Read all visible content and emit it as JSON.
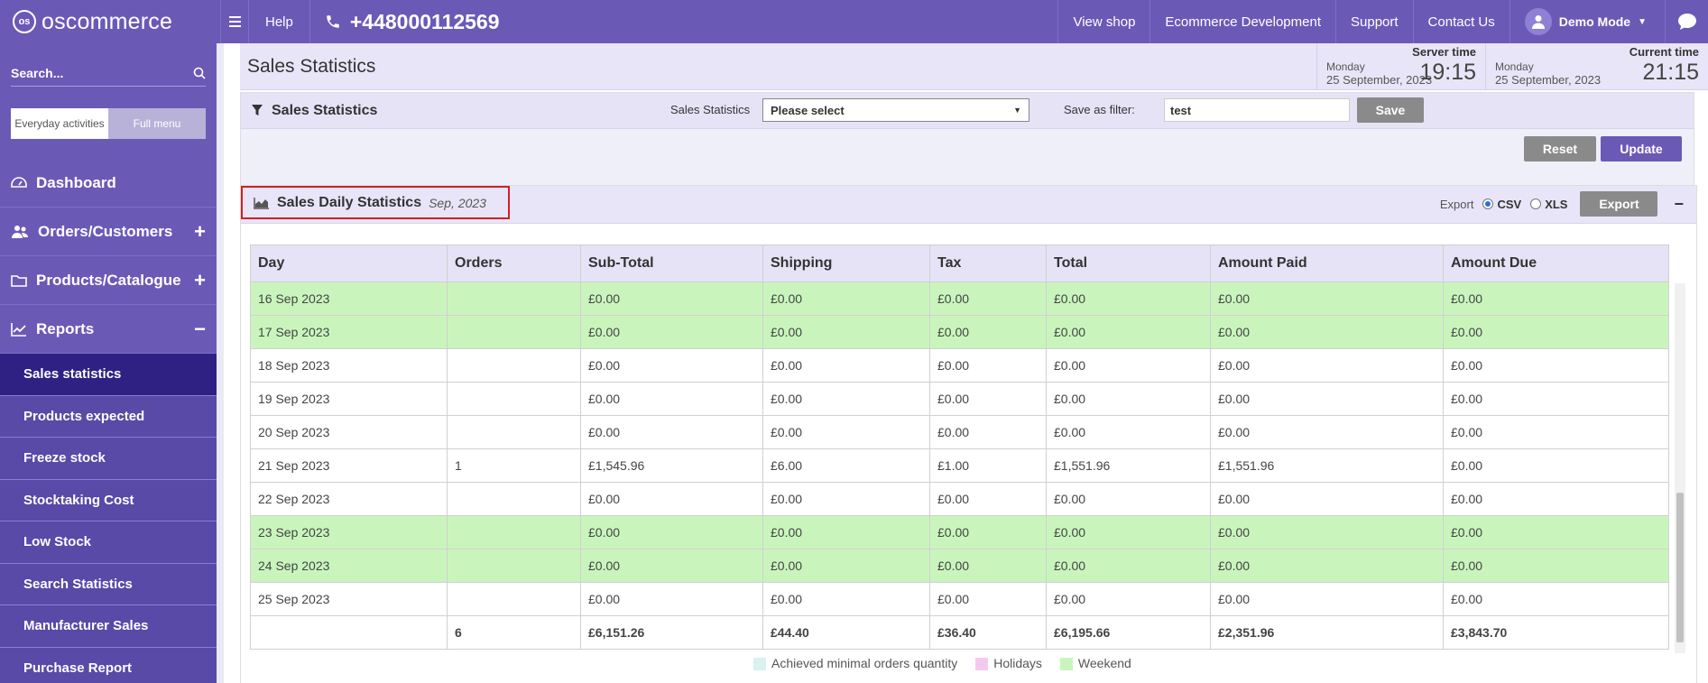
{
  "topbar": {
    "logo_text": "oscommerce",
    "help": "Help",
    "phone": "+448000112569",
    "links": [
      "View shop",
      "Ecommerce Development",
      "Support",
      "Contact Us"
    ],
    "user": "Demo Mode"
  },
  "sidebar": {
    "search_placeholder": "Search...",
    "mode_everyday": "Everyday activities",
    "mode_full": "Full menu",
    "nav": [
      {
        "label": "Dashboard"
      },
      {
        "label": "Orders/Customers",
        "toggle": "+"
      },
      {
        "label": "Products/Catalogue",
        "toggle": "+"
      },
      {
        "label": "Reports",
        "toggle": "−"
      }
    ],
    "sub_items": [
      "Sales statistics",
      "Products expected",
      "Freeze stock",
      "Stocktaking Cost",
      "Low Stock",
      "Search Statistics",
      "Manufacturer Sales",
      "Purchase Report"
    ]
  },
  "header": {
    "title": "Sales Statistics",
    "server_time_label": "Server time",
    "server_day": "Monday",
    "server_date": "25 September, 2023",
    "server_clock": "19:15",
    "current_time_label": "Current time",
    "current_day": "Monday",
    "current_date": "25 September, 2023",
    "current_clock": "21:15"
  },
  "filter": {
    "title": "Sales Statistics",
    "select_label": "Sales Statistics",
    "select_value": "Please select",
    "save_filter_label": "Save as filter:",
    "save_filter_value": "test",
    "save_button": "Save",
    "reset_button": "Reset",
    "update_button": "Update"
  },
  "stats": {
    "title": "Sales Daily Statistics",
    "period": "Sep, 2023",
    "export_label": "Export",
    "csv": "CSV",
    "xls": "XLS",
    "export_button": "Export",
    "collapse": "−"
  },
  "table": {
    "columns": [
      "Day",
      "Orders",
      "Sub-Total",
      "Shipping",
      "Tax",
      "Total",
      "Amount Paid",
      "Amount Due"
    ],
    "rows": [
      {
        "day": "16 Sep 2023",
        "orders": "",
        "subtotal": "£0.00",
        "shipping": "£0.00",
        "tax": "£0.00",
        "total": "£0.00",
        "paid": "£0.00",
        "due": "£0.00",
        "weekend": true
      },
      {
        "day": "17 Sep 2023",
        "orders": "",
        "subtotal": "£0.00",
        "shipping": "£0.00",
        "tax": "£0.00",
        "total": "£0.00",
        "paid": "£0.00",
        "due": "£0.00",
        "weekend": true
      },
      {
        "day": "18 Sep 2023",
        "orders": "",
        "subtotal": "£0.00",
        "shipping": "£0.00",
        "tax": "£0.00",
        "total": "£0.00",
        "paid": "£0.00",
        "due": "£0.00",
        "weekend": false
      },
      {
        "day": "19 Sep 2023",
        "orders": "",
        "subtotal": "£0.00",
        "shipping": "£0.00",
        "tax": "£0.00",
        "total": "£0.00",
        "paid": "£0.00",
        "due": "£0.00",
        "weekend": false
      },
      {
        "day": "20 Sep 2023",
        "orders": "",
        "subtotal": "£0.00",
        "shipping": "£0.00",
        "tax": "£0.00",
        "total": "£0.00",
        "paid": "£0.00",
        "due": "£0.00",
        "weekend": false
      },
      {
        "day": "21 Sep 2023",
        "orders": "1",
        "subtotal": "£1,545.96",
        "shipping": "£6.00",
        "tax": "£1.00",
        "total": "£1,551.96",
        "paid": "£1,551.96",
        "due": "£0.00",
        "weekend": false
      },
      {
        "day": "22 Sep 2023",
        "orders": "",
        "subtotal": "£0.00",
        "shipping": "£0.00",
        "tax": "£0.00",
        "total": "£0.00",
        "paid": "£0.00",
        "due": "£0.00",
        "weekend": false
      },
      {
        "day": "23 Sep 2023",
        "orders": "",
        "subtotal": "£0.00",
        "shipping": "£0.00",
        "tax": "£0.00",
        "total": "£0.00",
        "paid": "£0.00",
        "due": "£0.00",
        "weekend": true
      },
      {
        "day": "24 Sep 2023",
        "orders": "",
        "subtotal": "£0.00",
        "shipping": "£0.00",
        "tax": "£0.00",
        "total": "£0.00",
        "paid": "£0.00",
        "due": "£0.00",
        "weekend": true
      },
      {
        "day": "25 Sep 2023",
        "orders": "",
        "subtotal": "£0.00",
        "shipping": "£0.00",
        "tax": "£0.00",
        "total": "£0.00",
        "paid": "£0.00",
        "due": "£0.00",
        "weekend": false
      }
    ],
    "totals": {
      "day": "",
      "orders": "6",
      "subtotal": "£6,151.26",
      "shipping": "£44.40",
      "tax": "£36.40",
      "total": "£6,195.66",
      "paid": "£2,351.96",
      "due": "£3,843.70"
    }
  },
  "legend": [
    {
      "label": "Achieved minimal orders quantity",
      "color": "#d6f3ee"
    },
    {
      "label": "Holidays",
      "color": "#f4c9f0"
    },
    {
      "label": "Weekend",
      "color": "#c9f5bd"
    }
  ],
  "colors": {
    "brand": "#6a5ab6",
    "weekend": "#c9f5bd",
    "highlight": "#d21f25"
  }
}
